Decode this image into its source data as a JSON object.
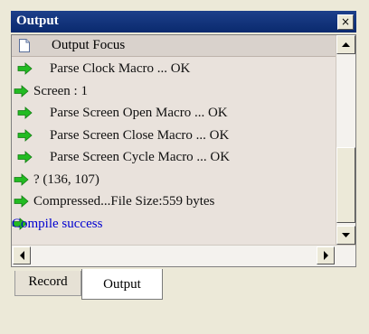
{
  "window": {
    "title": "Output",
    "close_label": "×"
  },
  "list": {
    "header_label": "Output Focus",
    "rows": [
      {
        "text": "Parse Clock Macro ... OK",
        "style": "indent"
      },
      {
        "text": "Screen : 1",
        "style": "flat"
      },
      {
        "text": "Parse Screen Open Macro ... OK",
        "style": "indent"
      },
      {
        "text": "Parse Screen Close Macro ... OK",
        "style": "indent"
      },
      {
        "text": "Parse Screen Cycle Macro ... OK",
        "style": "indent"
      },
      {
        "text": "? (136, 107)",
        "style": "flat"
      },
      {
        "text": "Compressed...File Size:559 bytes",
        "style": "flat"
      },
      {
        "text": "Compile success",
        "style": "success"
      }
    ]
  },
  "tabs": [
    {
      "label": "Record",
      "active": false
    },
    {
      "label": "Output",
      "active": true
    }
  ],
  "colors": {
    "title_bar": "#0a2a6e",
    "arrow_green": "#22bb22",
    "success_text": "#0000d0"
  }
}
